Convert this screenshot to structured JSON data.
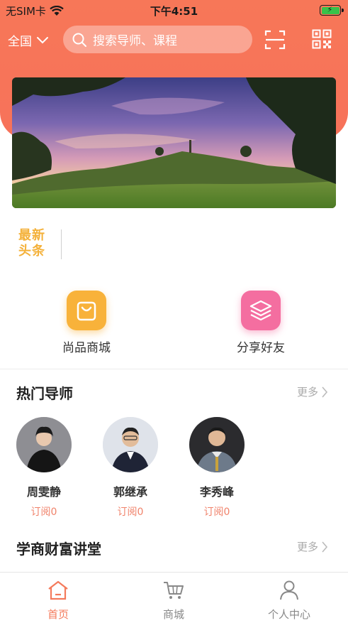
{
  "status_bar": {
    "carrier": "无SIM卡",
    "time": "下午4:51"
  },
  "header": {
    "region": "全国",
    "search_placeholder": "搜索导师、课程",
    "scan_icon": "scan-icon",
    "qr_icon": "qr-code-icon",
    "accent_color": "#f7745a"
  },
  "banner": {
    "scene": "landscape-photo"
  },
  "headline": {
    "line1": "最新",
    "line2": "头条"
  },
  "shortcuts": [
    {
      "label": "尚品商城",
      "icon": "shopping-bag-icon",
      "color": "#f8b23a"
    },
    {
      "label": "分享好友",
      "icon": "layers-icon",
      "color": "#f46ea0"
    }
  ],
  "hot_mentors": {
    "title": "热门导师",
    "more": "更多",
    "items": [
      {
        "name": "周雯静",
        "subscribe": "订阅0"
      },
      {
        "name": "郭继承",
        "subscribe": "订阅0"
      },
      {
        "name": "李秀峰",
        "subscribe": "订阅0"
      }
    ]
  },
  "lecture_hall": {
    "title": "学商财富讲堂",
    "more": "更多"
  },
  "tab_bar": [
    {
      "label": "首页",
      "icon": "home-icon",
      "active": true
    },
    {
      "label": "商城",
      "icon": "cart-icon",
      "active": false
    },
    {
      "label": "个人中心",
      "icon": "person-icon",
      "active": false
    }
  ]
}
